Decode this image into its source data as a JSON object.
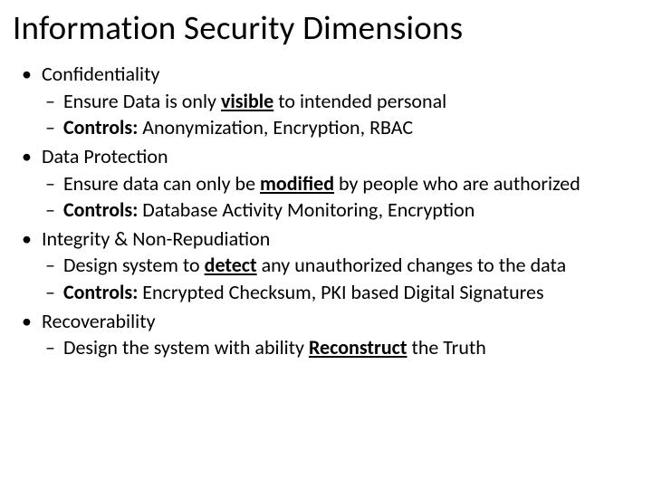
{
  "title": "Information Security Dimensions",
  "items": [
    {
      "label": "Confidentiality",
      "sub": [
        {
          "pre": "Ensure Data is only ",
          "emph": "visible",
          "emphStyle": "bu",
          "post": " to intended personal"
        },
        {
          "ctrlLabel": "Controls:",
          "ctrlText": " Anonymization, Encryption, RBAC"
        }
      ]
    },
    {
      "label": "Data Protection",
      "sub": [
        {
          "pre": "Ensure data can only be ",
          "emph": "modified",
          "emphStyle": "bu",
          "post": " by people who are authorized"
        },
        {
          "ctrlLabel": "Controls:",
          "ctrlText": " Database Activity Monitoring, Encryption"
        }
      ]
    },
    {
      "label": "Integrity & Non-Repudiation",
      "sub": [
        {
          "pre": "Design system to ",
          "emph": "detect",
          "emphStyle": "bu",
          "post": " any unauthorized changes to the data"
        },
        {
          "ctrlLabel": "Controls:",
          "ctrlText": " Encrypted Checksum, PKI based Digital Signatures"
        }
      ]
    },
    {
      "label": "Recoverability",
      "sub": [
        {
          "pre": "Design the system with ability ",
          "emph": "Reconstruct",
          "emphStyle": "bu",
          "post": " the Truth"
        }
      ]
    }
  ]
}
